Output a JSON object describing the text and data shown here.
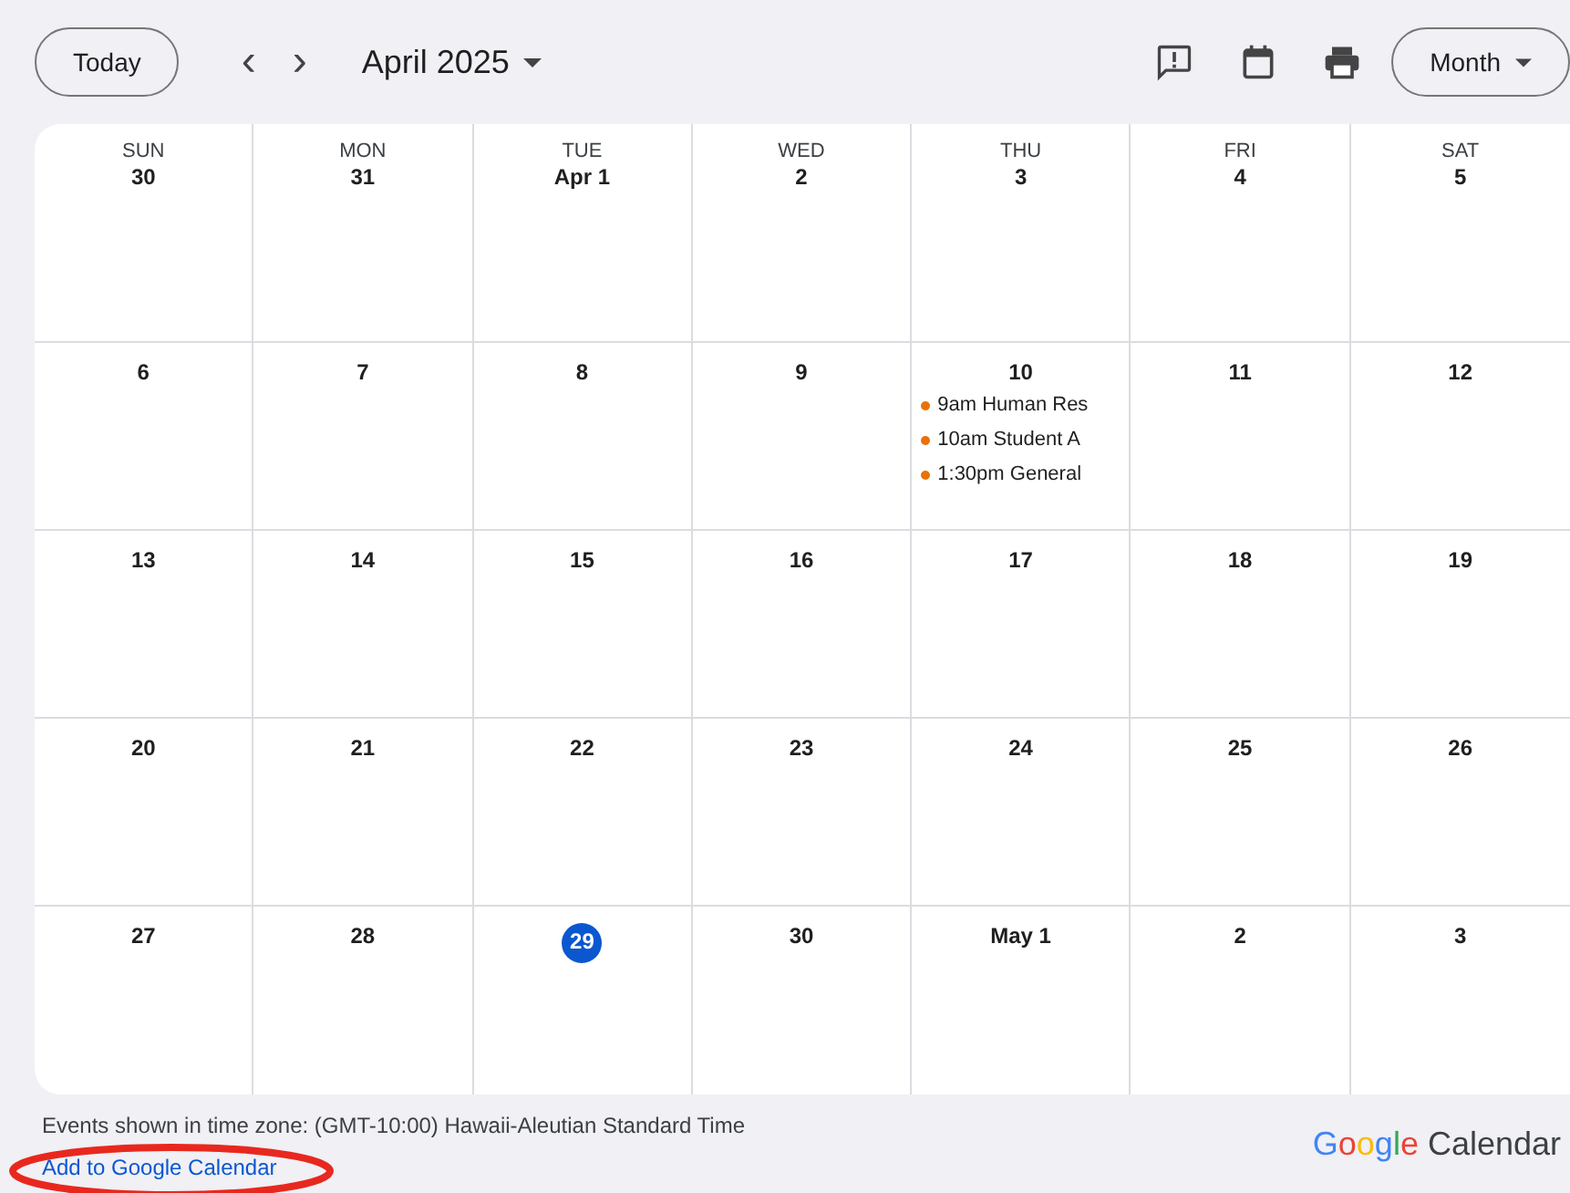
{
  "toolbar": {
    "today_button": "Today",
    "prev": "‹",
    "next": "›",
    "month_title": "April 2025",
    "view_button": "Month"
  },
  "weekdays": [
    "SUN",
    "MON",
    "TUE",
    "WED",
    "THU",
    "FRI",
    "SAT"
  ],
  "weeks": [
    [
      {
        "date": "30",
        "today": false
      },
      {
        "date": "31",
        "today": false
      },
      {
        "date": "Apr 1",
        "today": false
      },
      {
        "date": "2",
        "today": false
      },
      {
        "date": "3",
        "today": false
      },
      {
        "date": "4",
        "today": false
      },
      {
        "date": "5",
        "today": false
      }
    ],
    [
      {
        "date": "6",
        "today": false
      },
      {
        "date": "7",
        "today": false
      },
      {
        "date": "8",
        "today": false
      },
      {
        "date": "9",
        "today": false
      },
      {
        "date": "10",
        "today": false,
        "events": [
          {
            "time": "9am",
            "title": "Human Res"
          },
          {
            "time": "10am",
            "title": "Student A"
          },
          {
            "time": "1:30pm",
            "title": "General"
          }
        ]
      },
      {
        "date": "11",
        "today": false
      },
      {
        "date": "12",
        "today": false
      }
    ],
    [
      {
        "date": "13",
        "today": false
      },
      {
        "date": "14",
        "today": false
      },
      {
        "date": "15",
        "today": false
      },
      {
        "date": "16",
        "today": false
      },
      {
        "date": "17",
        "today": false
      },
      {
        "date": "18",
        "today": false
      },
      {
        "date": "19",
        "today": false
      }
    ],
    [
      {
        "date": "20",
        "today": false
      },
      {
        "date": "21",
        "today": false
      },
      {
        "date": "22",
        "today": false
      },
      {
        "date": "23",
        "today": false
      },
      {
        "date": "24",
        "today": false
      },
      {
        "date": "25",
        "today": false
      },
      {
        "date": "26",
        "today": false
      }
    ],
    [
      {
        "date": "27",
        "today": false
      },
      {
        "date": "28",
        "today": false
      },
      {
        "date": "29",
        "today": true
      },
      {
        "date": "30",
        "today": false
      },
      {
        "date": "May 1",
        "today": false
      },
      {
        "date": "2",
        "today": false
      },
      {
        "date": "3",
        "today": false
      }
    ]
  ],
  "footer": {
    "timezone_note": "Events shown in time zone: (GMT-10:00) Hawaii-Aleutian Standard Time",
    "add_link": "Add to Google Calendar",
    "logo_word": "Google",
    "logo_product": "Calendar"
  }
}
